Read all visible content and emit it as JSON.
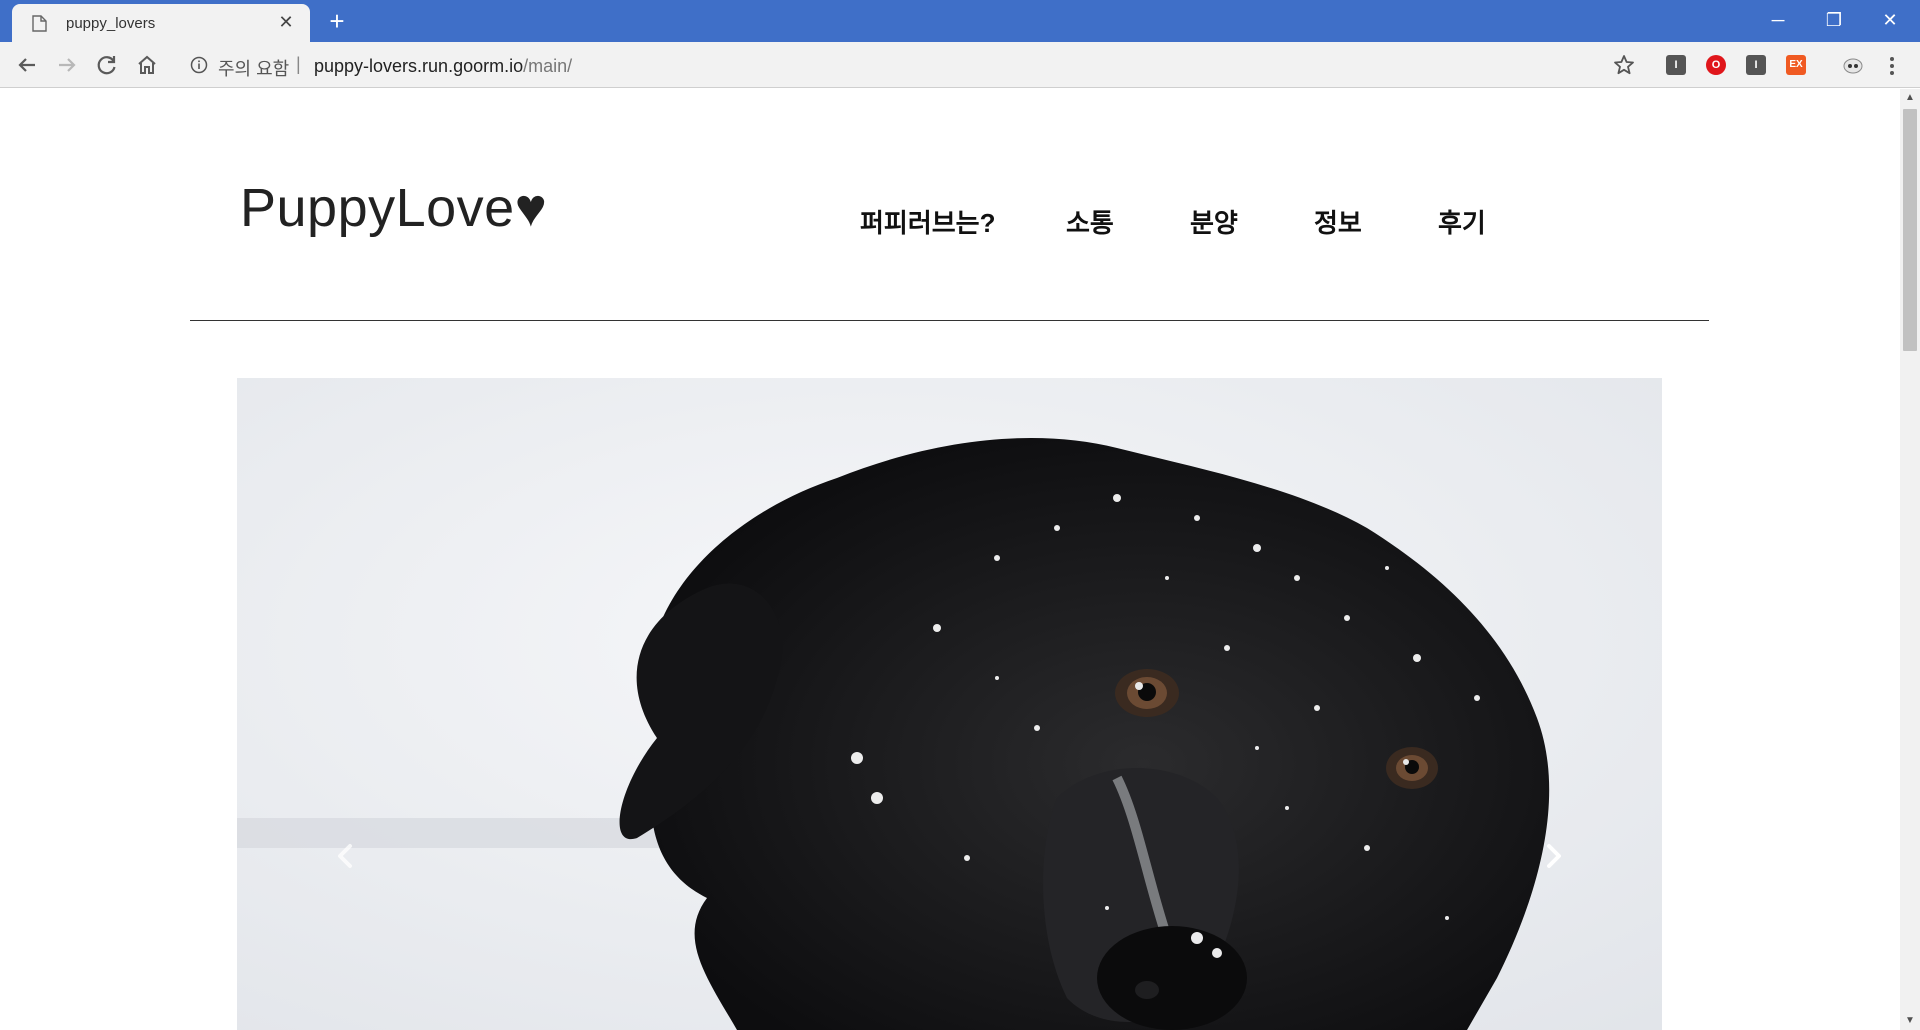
{
  "browser": {
    "tab_title": "puppy_lovers",
    "tab_close": "✕",
    "new_tab": "+",
    "security_warning": "주의 요함",
    "separator": "|",
    "url_host": "puppy-lovers.run.goorm.io",
    "url_path": "/main/",
    "window_controls": {
      "minimize": "─",
      "restore": "❐",
      "close": "✕"
    },
    "extensions": [
      {
        "name": "extension-i-1",
        "label": "I",
        "color": "#555555"
      },
      {
        "name": "extension-opera",
        "label": "O",
        "color": "#e0161b"
      },
      {
        "name": "extension-i-2",
        "label": "I",
        "color": "#555555"
      },
      {
        "name": "extension-ex",
        "label": "EX",
        "color": "#f05a22"
      }
    ]
  },
  "site": {
    "logo": "PuppyLove♥",
    "nav": [
      {
        "label": "퍼피러브는?"
      },
      {
        "label": "소통"
      },
      {
        "label": "분양"
      },
      {
        "label": "정보"
      },
      {
        "label": "후기"
      }
    ],
    "carousel": {
      "prev_icon": "chevron-left",
      "next_icon": "chevron-right",
      "image": "black dog in snow"
    }
  },
  "scrollbar": {
    "up": "▲",
    "down": "▼"
  }
}
